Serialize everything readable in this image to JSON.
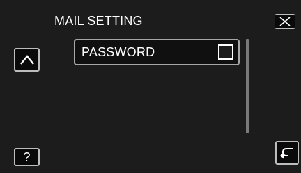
{
  "header": {
    "title": "MAIL SETTING"
  },
  "menu": {
    "items": [
      {
        "label": "PASSWORD",
        "checked": false
      }
    ]
  },
  "icons": {
    "close": "close-icon",
    "up": "chevron-up-icon",
    "help": "help-icon",
    "back": "back-arrow-icon"
  },
  "help_label": "?",
  "colors": {
    "background": "#1c1c1c",
    "border": "#a7a7a7",
    "text": "#ffffff"
  }
}
